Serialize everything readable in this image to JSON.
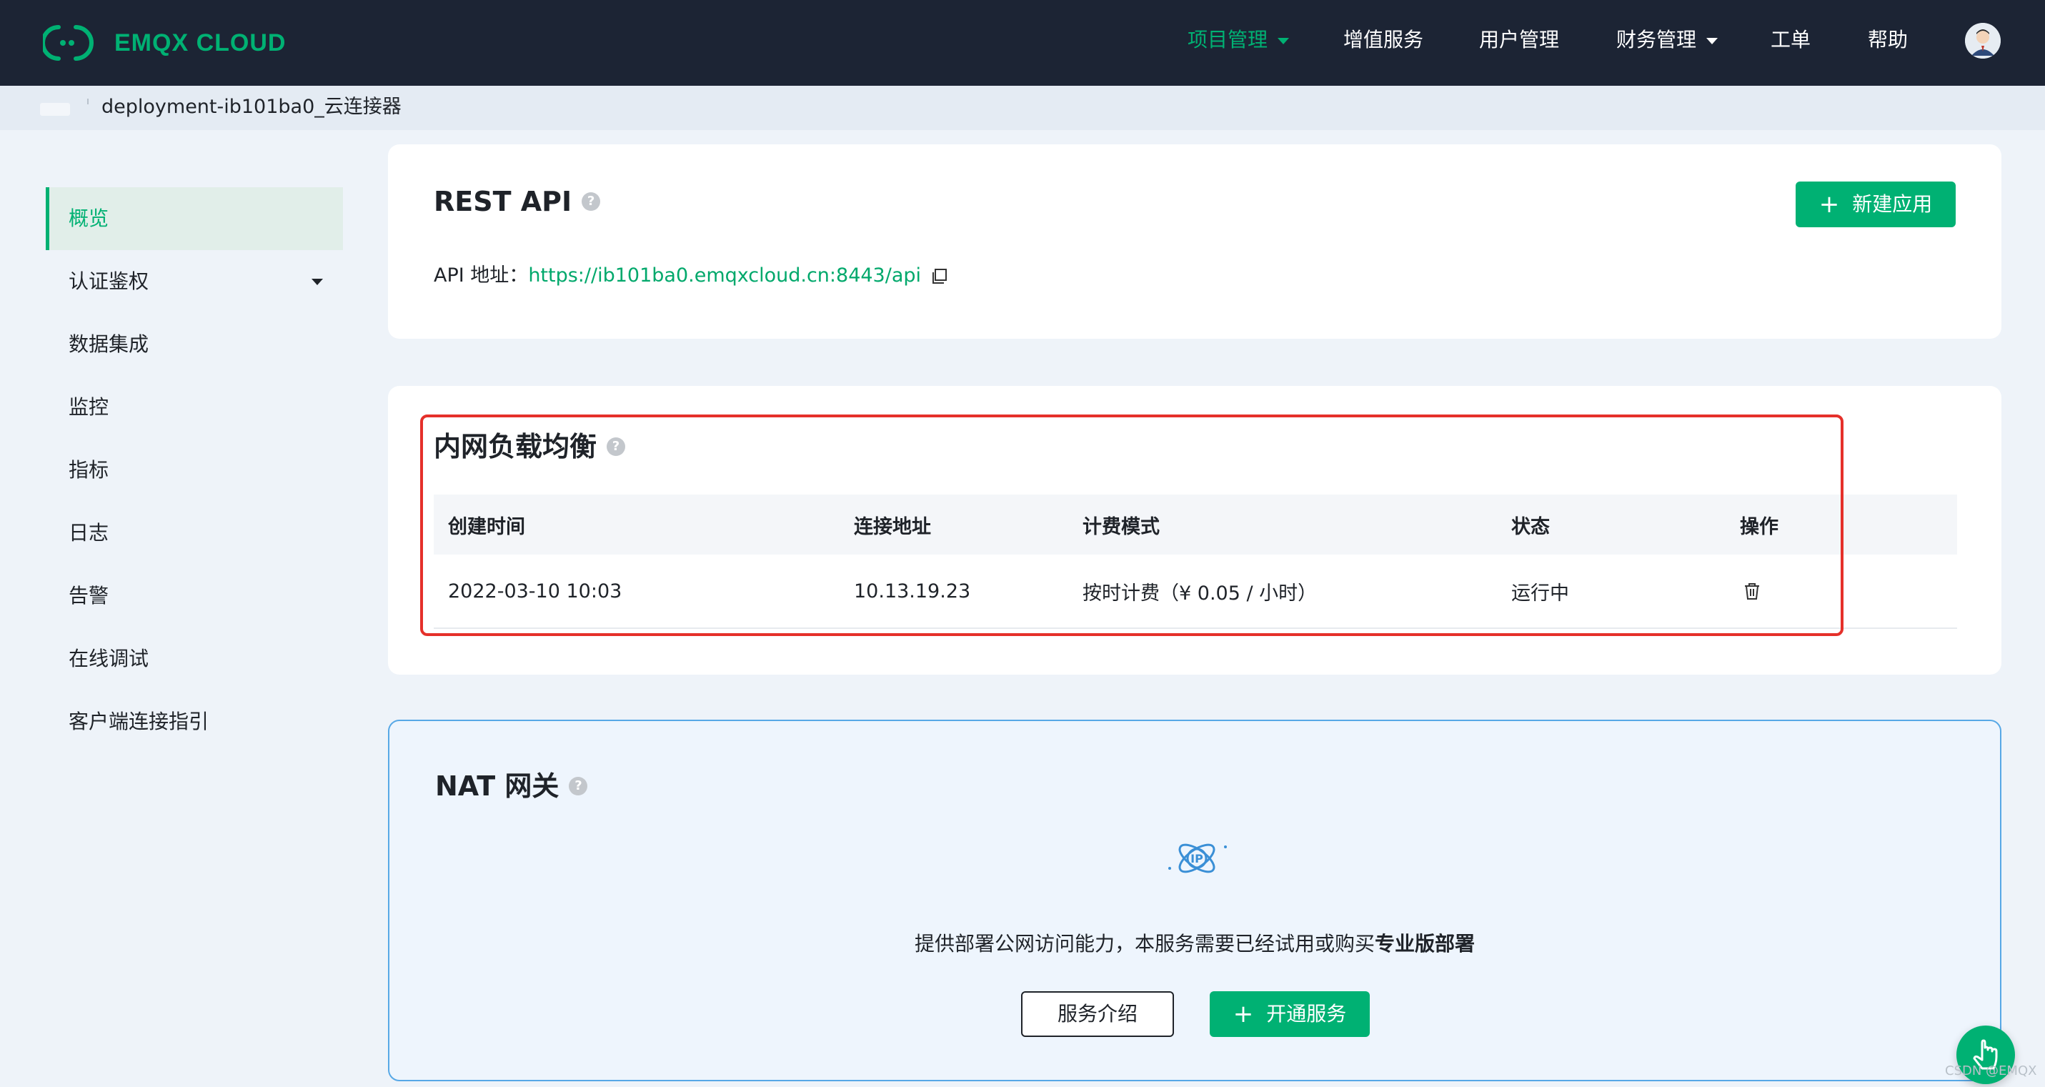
{
  "brand": {
    "name": "EMQX CLOUD",
    "accent": "#00b173",
    "nav_bg": "#1c2434"
  },
  "nav": {
    "items": [
      {
        "label": "项目管理",
        "active": true,
        "dropdown": true
      },
      {
        "label": "增值服务"
      },
      {
        "label": "用户管理"
      },
      {
        "label": "财务管理",
        "dropdown": true
      },
      {
        "label": "工单"
      },
      {
        "label": "帮助"
      }
    ]
  },
  "breadcrumb": {
    "current": "deployment-ib101ba0_云连接器"
  },
  "sidebar": {
    "items": [
      {
        "label": "概览",
        "active": true
      },
      {
        "label": "认证鉴权",
        "dropdown": true
      },
      {
        "label": "数据集成"
      },
      {
        "label": "监控"
      },
      {
        "label": "指标"
      },
      {
        "label": "日志"
      },
      {
        "label": "告警"
      },
      {
        "label": "在线调试"
      },
      {
        "label": "客户端连接指引"
      }
    ]
  },
  "rest_api": {
    "title": "REST API",
    "new_app_label": "新建应用",
    "api_label": "API 地址：",
    "api_url": "https://ib101ba0.emqxcloud.cn:8443/api"
  },
  "lb": {
    "title": "内网负载均衡",
    "columns": [
      "创建时间",
      "连接地址",
      "计费模式",
      "状态",
      "操作"
    ],
    "rows": [
      {
        "created": "2022-03-10 10:03",
        "address": "10.13.19.23",
        "billing": "按时计费（¥ 0.05 / 小时）",
        "status": "运行中"
      }
    ]
  },
  "nat": {
    "title": "NAT 网关",
    "desc_prefix": "提供部署公网访问能力，本服务需要已经试用或购买",
    "desc_bold": "专业版部署",
    "intro_label": "服务介绍",
    "open_label": "开通服务"
  },
  "watermark": "CSDN @EMQX"
}
